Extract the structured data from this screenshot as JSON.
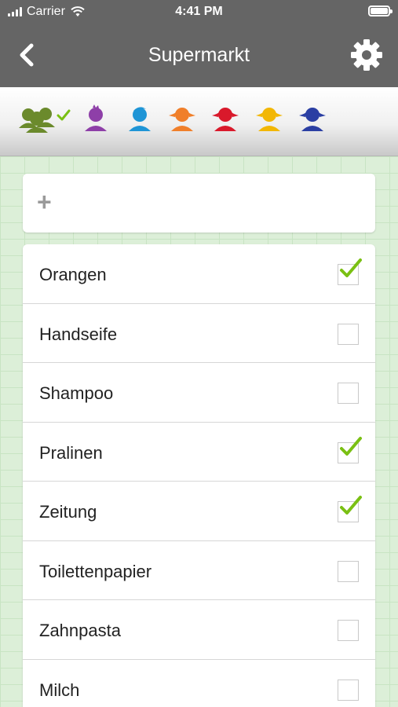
{
  "status_bar": {
    "carrier": "Carrier",
    "time": "4:41 PM"
  },
  "nav": {
    "title": "Supermarkt",
    "back_icon": "chevron-left-icon",
    "settings_icon": "gear-icon"
  },
  "avatars": [
    {
      "name": "group-avatar-icon",
      "color": "#6b8a2c",
      "selected": true
    },
    {
      "name": "purple-avatar-icon",
      "color": "#8e3fa8"
    },
    {
      "name": "blue-avatar-icon",
      "color": "#1f95d6"
    },
    {
      "name": "orange-avatar-icon",
      "color": "#f07f2a"
    },
    {
      "name": "red-avatar-icon",
      "color": "#d9192b"
    },
    {
      "name": "yellow-avatar-icon",
      "color": "#f2b705"
    },
    {
      "name": "darkblue-avatar-icon",
      "color": "#2b3fa3"
    }
  ],
  "add_item": {
    "icon": "+"
  },
  "items": [
    {
      "label": "Orangen",
      "checked": true
    },
    {
      "label": "Handseife",
      "checked": false
    },
    {
      "label": "Shampoo",
      "checked": false
    },
    {
      "label": "Pralinen",
      "checked": true
    },
    {
      "label": "Zeitung",
      "checked": true
    },
    {
      "label": "Toilettenpapier",
      "checked": false
    },
    {
      "label": "Zahnpasta",
      "checked": false
    },
    {
      "label": "Milch",
      "checked": false
    }
  ],
  "colors": {
    "check": "#7ac013",
    "header": "#656565",
    "background": "#dcefd8"
  }
}
